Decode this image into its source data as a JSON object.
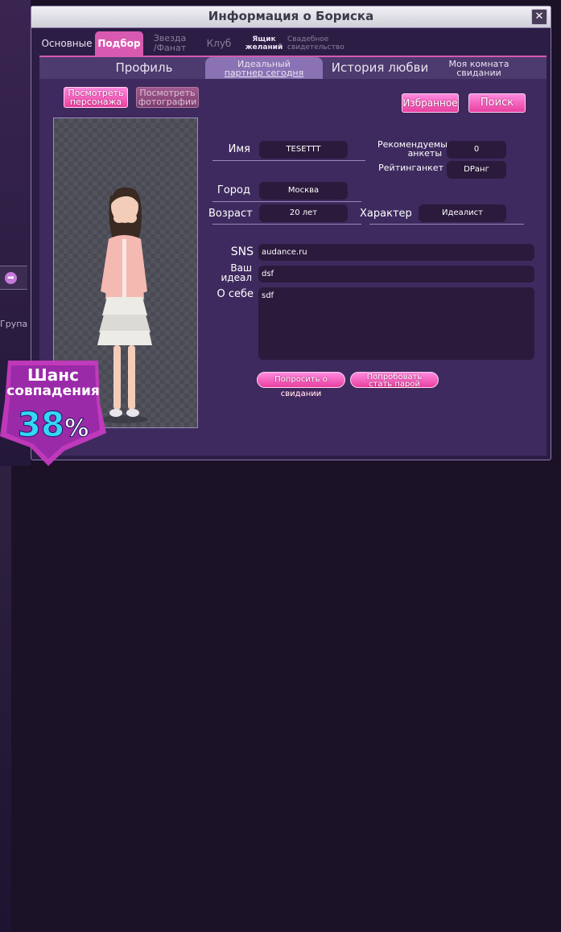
{
  "window": {
    "title": "Информация о Бориска"
  },
  "tabs": [
    {
      "label": "Основные",
      "active": false
    },
    {
      "label": "Подбор",
      "active": true
    },
    {
      "line1": "Звезда",
      "line2": "/Фанат",
      "dim": true
    },
    {
      "label": "Клуб",
      "active": false,
      "dim": true
    },
    {
      "line1": "Ящик",
      "line2": "желаний",
      "active": false
    },
    {
      "line1": "Свадебное",
      "line2": "свидетельство",
      "dim": true
    }
  ],
  "subtabs": [
    {
      "label": "Профиль",
      "active": false
    },
    {
      "line1": "Идеальный",
      "line2": "партнер сегодня",
      "active": true
    },
    {
      "label": "История любви",
      "active": false
    },
    {
      "line1": "Моя комната",
      "line2": "свидании",
      "active": false
    }
  ],
  "buttons": {
    "view_character": {
      "line1": "Посмотреть",
      "line2": "персонажа"
    },
    "view_photos": {
      "line1": "Посмотреть",
      "line2": "фотографии"
    },
    "favorites": "Избранное",
    "search": "Поиск",
    "ask_date": "Попросить о свидании",
    "try_couple": {
      "line1": "Попробовать",
      "line2": "стать парой"
    }
  },
  "profile": {
    "name_label": "Имя",
    "name_value": "TESETTT",
    "recommended_label": {
      "line1": "Рекомендуемые",
      "line2": "анкеты"
    },
    "recommended_value": "0",
    "rating_label": "Рейтинганкет",
    "rating_value": "DРанг",
    "city_label": "Город",
    "city_value": "Москва",
    "age_label": "Возраст",
    "age_value": "20 лет",
    "character_label": "Характер",
    "character_value": "Идеалист",
    "sns_label": "SNS",
    "sns_value": "audance.ru",
    "ideal_label": {
      "line1": "Ваш",
      "line2": "идеал"
    },
    "ideal_value": "dsf",
    "about_label": "О себе",
    "about_value": "sdf"
  },
  "match_badge": {
    "line1": "Шанс",
    "line2": "совпадения",
    "percent_value": "38",
    "percent_sign": "%"
  },
  "background": {
    "left_btn_glyph": "➡",
    "left_text": "Група"
  },
  "colors": {
    "accent_pink": "#e9409f",
    "window_bg": "#3e2a5e",
    "field_bg": "#2b1a3c"
  }
}
